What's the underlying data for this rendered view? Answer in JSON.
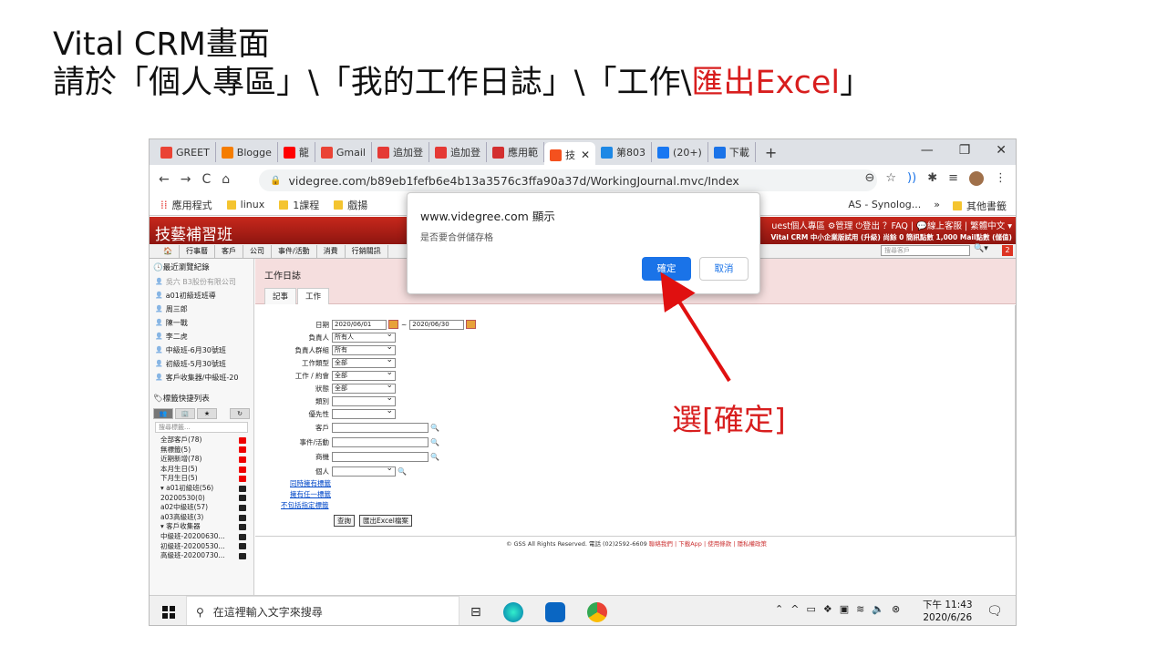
{
  "slide": {
    "title_line1": "Vital CRM畫面",
    "title_line2_black": "請於「個人專區」\\「我的工作日誌」\\「工作\\",
    "title_line2_red": "匯出Excel",
    "title_line2_end": "」",
    "annotation": "選[確定]",
    "accent_color": "#d81e1e"
  },
  "browser": {
    "tabs": [
      {
        "label": "GREET",
        "icon_color": "#ea4335"
      },
      {
        "label": "Blogge",
        "icon_color": "#f57d00"
      },
      {
        "label": "龍",
        "icon_color": "#ff0000"
      },
      {
        "label": "Gmail",
        "icon_color": "#ea4335"
      },
      {
        "label": "追加登",
        "icon_color": "#e53935"
      },
      {
        "label": "追加登",
        "icon_color": "#e53935"
      },
      {
        "label": "應用範",
        "icon_color": "#d32f2f"
      },
      {
        "label": "技",
        "icon_color": "#f4511e"
      },
      {
        "label": "第803",
        "icon_color": "#1e88e5"
      },
      {
        "label": "(20+)",
        "icon_color": "#1877f2"
      },
      {
        "label": "下載",
        "icon_color": "#1a73e8"
      }
    ],
    "new_tab": "+",
    "window_controls": [
      "—",
      "❐",
      "✕"
    ],
    "url": "videgree.com/b89eb1fefb6e4b13a3576c3ffa90a37d/WorkingJournal.mvc/Index",
    "bookmarks": [
      "應用程式",
      "linux",
      "1課程",
      "戲揚"
    ],
    "bookmark_right": [
      "AS - Synolog...",
      "»",
      "其他書籤"
    ]
  },
  "crm": {
    "logo": "技藝補習班",
    "top_links": "uest個人專區 ⚙管理 ⏻登出 ？FAQ | 💬線上客服 | 繁體中文 ▾",
    "sub_info": "Vital CRM 中小企業版試用 (升級) 尚餘 0 簡訊點數 1,000 Mail點數 (儲值)",
    "menu": [
      "🏠",
      "行事曆",
      "客戶",
      "公司",
      "事件/活動",
      "消費",
      "行銷關訊"
    ],
    "search_placeholder": "搜尋客戶",
    "badge": "2",
    "sidebar": {
      "recent_header": "最近瀏覽紀錄",
      "recent_items": [
        {
          "label": "吳六 B3股份有限公司",
          "dim": true
        },
        {
          "label": "a01初級班班導",
          "dim": false
        },
        {
          "label": "周三郎",
          "dim": false
        },
        {
          "label": "陳一戰",
          "dim": false
        },
        {
          "label": "李二虎",
          "dim": false
        },
        {
          "label": "中級班-6月30號班",
          "dim": false
        },
        {
          "label": "初級班-5月30號班",
          "dim": false
        },
        {
          "label": "客戶收集器/中級班-20",
          "dim": false
        }
      ],
      "tags_header": "標籤快捷列表",
      "tag_search": "搜尋標籤...",
      "tags": [
        {
          "label": "全部客戶(78)",
          "color": "#e00"
        },
        {
          "label": "無標籤(5)",
          "color": "#e00"
        },
        {
          "label": "近期新增(78)",
          "color": "#e00"
        },
        {
          "label": "本月生日(5)",
          "color": "#e00"
        },
        {
          "label": "下月生日(5)",
          "color": "#e00"
        },
        {
          "label": "▾ a01初級班(56)",
          "color": "#222"
        },
        {
          "label": "20200530(0)",
          "color": "#222"
        },
        {
          "label": "a02中級班(57)",
          "color": "#222"
        },
        {
          "label": "a03高級班(3)",
          "color": "#222"
        },
        {
          "label": "▾ 客戶收集器",
          "color": "#222"
        },
        {
          "label": "中級班-20200630...",
          "color": "#222"
        },
        {
          "label": "初級班-20200530...",
          "color": "#222"
        },
        {
          "label": "高級班-20200730...",
          "color": "#222"
        }
      ]
    },
    "work": {
      "title": "工作日誌",
      "tabs": [
        "記事",
        "工作"
      ],
      "fields": {
        "date_label": "日期",
        "date_from": "2020/06/01",
        "date_sep": "~",
        "date_to": "2020/06/30",
        "owner_label": "負責人",
        "owner_value": "所有人",
        "owner_group_label": "負責人群組",
        "owner_group_value": "所有",
        "type_label": "工作類型",
        "type_value": "全部",
        "work_label": "工作 / 約會",
        "work_value": "全部",
        "status_label": "狀態",
        "status_value": "全部",
        "category_label": "類別",
        "priority_label": "優先性",
        "customer_label": "客戶",
        "event_label": "事件/活動",
        "product_label": "商機",
        "person_label": "個人"
      },
      "links": [
        "同時擁有標籤",
        "擁有任一標籤",
        "不包括指定標籤"
      ],
      "query_button": "查詢",
      "export_button": "匯出Excel檔案"
    },
    "footer": "© GSS All Rights Reserved. 電話 (02)2592-6609",
    "footer_links": "聯絡我們 | 下載App | 使用條款 | 隱私權政策"
  },
  "dialog": {
    "title": "www.videgree.com 顯示",
    "message": "是否要合併儲存格",
    "ok": "確定",
    "cancel": "取消"
  },
  "taskbar": {
    "search_placeholder": "在這裡輸入文字來搜尋",
    "time": "下午 11:43",
    "date": "2020/6/26"
  }
}
